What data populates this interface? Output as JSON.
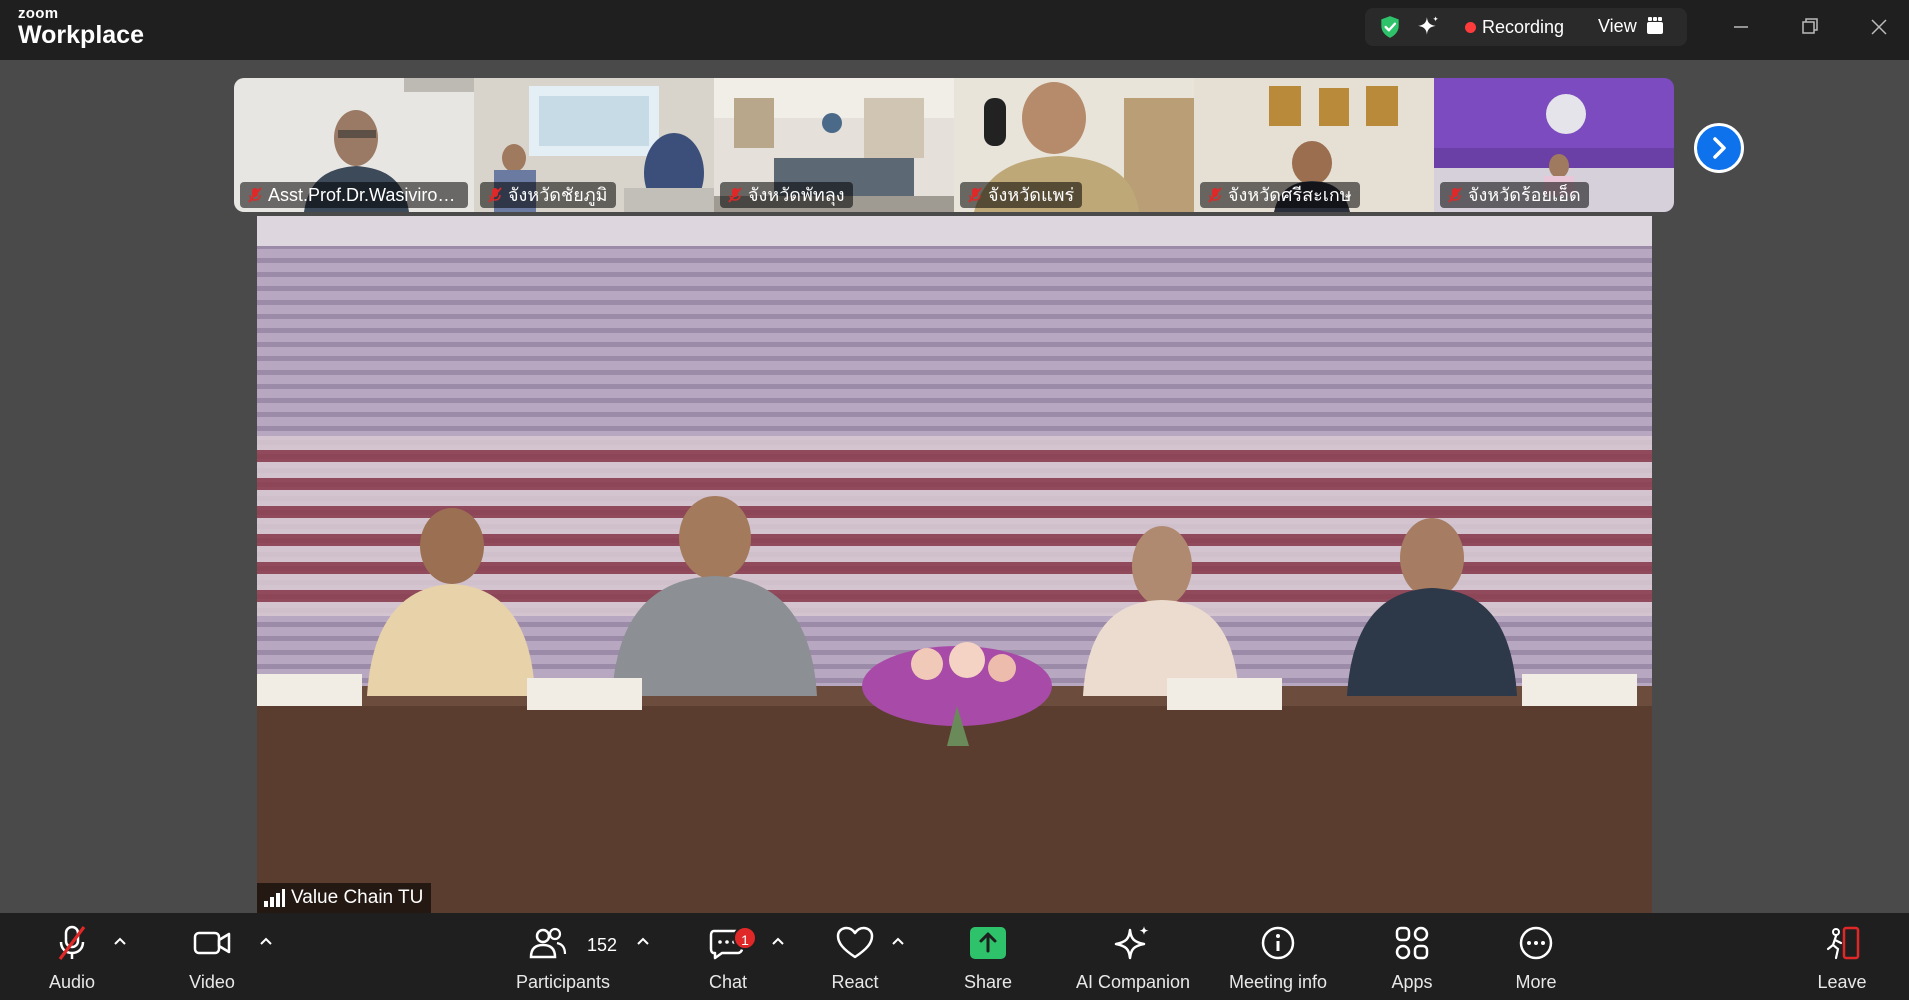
{
  "app": {
    "logo_small": "zoom",
    "logo_main": "Workplace"
  },
  "top_controls": {
    "recording_label": "Recording",
    "view_label": "View"
  },
  "thumbnails": [
    {
      "name": "Asst.Prof.Dr.Wasivirot ..."
    },
    {
      "name": "จังหวัดชัยภูมิ"
    },
    {
      "name": "จังหวัดพัทลุง"
    },
    {
      "name": "จังหวัดแพร่"
    },
    {
      "name": "จังหวัดศรีสะเกษ"
    },
    {
      "name": "จังหวัดร้อยเอ็ด"
    }
  ],
  "main_video": {
    "speaker_label": "Value Chain TU"
  },
  "toolbar": {
    "audio_label": "Audio",
    "video_label": "Video",
    "participants_label": "Participants",
    "participants_count": "152",
    "chat_label": "Chat",
    "chat_badge": "1",
    "react_label": "React",
    "share_label": "Share",
    "ai_label": "AI Companion",
    "info_label": "Meeting info",
    "apps_label": "Apps",
    "more_label": "More",
    "leave_label": "Leave"
  },
  "colors": {
    "accent_blue": "#0e72ed",
    "share_green": "#2ec26b",
    "recording_red": "#ff3b3b",
    "badge_red": "#e02828",
    "leave_red": "#e02828"
  }
}
